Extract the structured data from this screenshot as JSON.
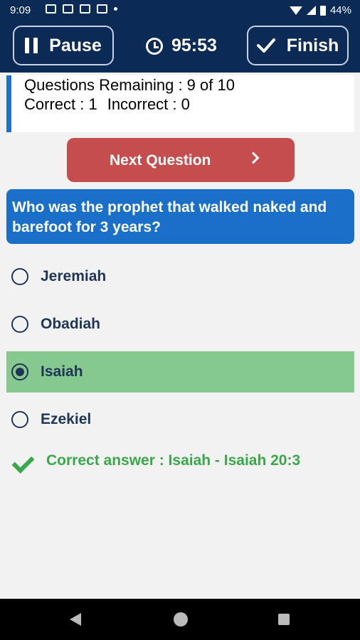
{
  "status_bar": {
    "time": "9:09",
    "battery": "44%",
    "icons": [
      "image-icon",
      "photos-icon",
      "mail-icon",
      "gmail-icon",
      "notification-dot-icon",
      "wifi-icon",
      "signal-icon",
      "battery-icon"
    ]
  },
  "toolbar": {
    "pause_label": "Pause",
    "timer": "95:53",
    "finish_label": "Finish"
  },
  "progress": {
    "remaining": "Questions Remaining : 9 of 10",
    "correct": "Correct : 1",
    "incorrect": "Incorrect : 0"
  },
  "next_button": {
    "label": "Next Question"
  },
  "question": {
    "text": "Who was the prophet that walked naked and barefoot for 3 years?"
  },
  "options": [
    {
      "label": "Jeremiah",
      "selected": false
    },
    {
      "label": "Obadiah",
      "selected": false
    },
    {
      "label": "Isaiah",
      "selected": true
    },
    {
      "label": "Ezekiel",
      "selected": false
    }
  ],
  "result": {
    "text": "Correct answer : Isaiah - Isaiah 20:3"
  },
  "colors": {
    "header": "#0b2a55",
    "accent_blue": "#1a6fc8",
    "next_button": "#c64d4d",
    "selected_option": "#86c990",
    "correct_text": "#3aa84a"
  }
}
